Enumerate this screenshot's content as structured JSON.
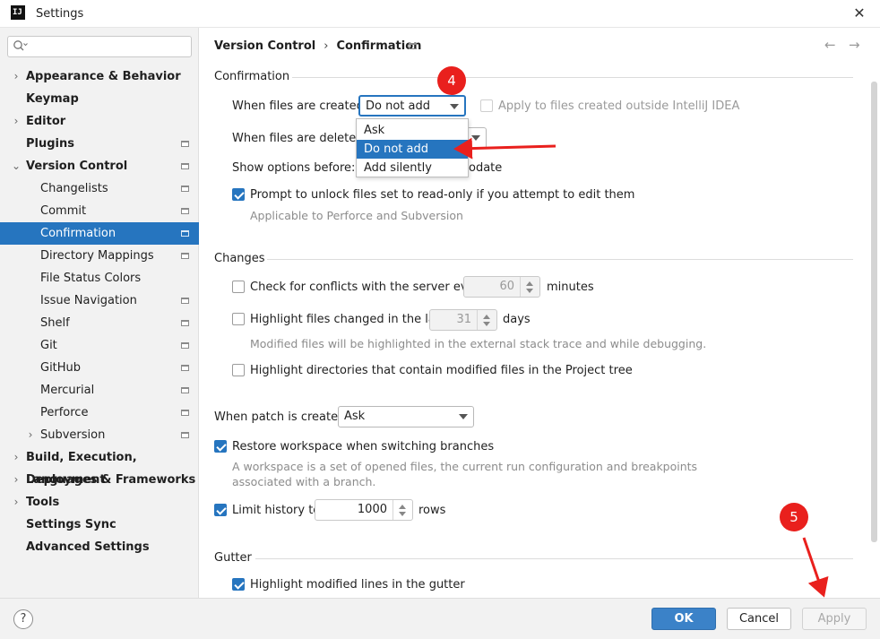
{
  "window": {
    "title": "Settings",
    "app_icon": "intellij-icon",
    "close_glyph": "✕"
  },
  "search": {
    "placeholder": "",
    "value": ""
  },
  "sidebar": {
    "items": [
      {
        "label": "Appearance & Behavior",
        "bold": true,
        "expand": "right"
      },
      {
        "label": "Keymap",
        "bold": true
      },
      {
        "label": "Editor",
        "bold": true,
        "expand": "right"
      },
      {
        "label": "Plugins",
        "bold": true,
        "project_icon": true
      },
      {
        "label": "Version Control",
        "bold": true,
        "expand": "down",
        "project_icon": true
      },
      {
        "label": "Changelists",
        "project_icon": true
      },
      {
        "label": "Commit",
        "project_icon": true
      },
      {
        "label": "Confirmation",
        "project_icon": true,
        "selected": true
      },
      {
        "label": "Directory Mappings",
        "project_icon": true
      },
      {
        "label": "File Status Colors"
      },
      {
        "label": "Issue Navigation",
        "project_icon": true
      },
      {
        "label": "Shelf",
        "project_icon": true
      },
      {
        "label": "Git",
        "project_icon": true
      },
      {
        "label": "GitHub",
        "project_icon": true
      },
      {
        "label": "Mercurial",
        "project_icon": true
      },
      {
        "label": "Perforce",
        "project_icon": true
      },
      {
        "label": "Subversion",
        "expand": "right",
        "project_icon": true
      },
      {
        "label": "Build, Execution, Deployment",
        "bold": true,
        "expand": "right"
      },
      {
        "label": "Languages & Frameworks",
        "bold": true,
        "expand": "right"
      },
      {
        "label": "Tools",
        "bold": true,
        "expand": "right"
      },
      {
        "label": "Settings Sync",
        "bold": true
      },
      {
        "label": "Advanced Settings",
        "bold": true
      }
    ]
  },
  "breadcrumb": {
    "parent": "Version Control",
    "separator": "›",
    "current": "Confirmation",
    "back_glyph": "←",
    "forward_glyph": "→"
  },
  "confirmation": {
    "section_title": "Confirmation",
    "files_created_label": "When files are created:",
    "files_created_value": "Do not add",
    "apply_outside_label": "Apply to files created outside IntelliJ IDEA",
    "files_deleted_label": "When files are deleted:",
    "show_options_label": "Show options before:",
    "show_options_suffix": "odate",
    "prompt_unlock_label": "Prompt to unlock files set to read-only if you attempt to edit them",
    "prompt_unlock_hint": "Applicable to Perforce and Subversion"
  },
  "dropdown_options": {
    "items": [
      "Ask",
      "Do not add",
      "Add silently"
    ],
    "selected": "Do not add"
  },
  "changes": {
    "section_title": "Changes",
    "check_conflicts_label": "Check for conflicts with the server every",
    "check_conflicts_value": "60",
    "check_conflicts_unit": "minutes",
    "highlight_changed_label": "Highlight files changed in the last",
    "highlight_changed_value": "31",
    "highlight_changed_unit": "days",
    "highlight_changed_hint": "Modified files will be highlighted in the external stack trace and while debugging.",
    "highlight_dirs_label": "Highlight directories that contain modified files in the Project tree"
  },
  "patch": {
    "label": "When patch is created:",
    "value": "Ask"
  },
  "restore": {
    "label": "Restore workspace when switching branches",
    "hint_line1": "A workspace is a set of opened files, the current run configuration and breakpoints",
    "hint_line2": "associated with a branch."
  },
  "history": {
    "label": "Limit history to",
    "value": "1000",
    "unit": "rows"
  },
  "gutter": {
    "section_title": "Gutter",
    "highlight_lines_label": "Highlight modified lines in the gutter"
  },
  "annotations": {
    "badge_4": "4",
    "badge_5": "5",
    "color": "#e9201d"
  },
  "footer": {
    "help": "?",
    "ok": "OK",
    "cancel": "Cancel",
    "apply": "Apply"
  },
  "colors": {
    "accent": "#2675bf",
    "sidebar_bg": "#f2f2f2",
    "annotation_red": "#e9201d"
  }
}
